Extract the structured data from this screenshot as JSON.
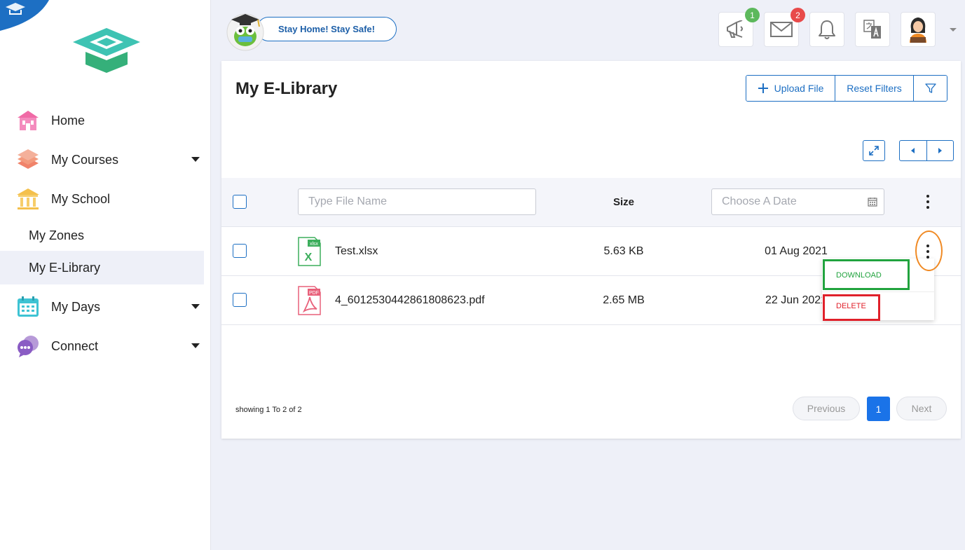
{
  "sidebar": {
    "items": [
      {
        "label": "Home"
      },
      {
        "label": "My Courses"
      },
      {
        "label": "My School"
      },
      {
        "label": "My Zones"
      },
      {
        "label": "My E-Library"
      },
      {
        "label": "My Days"
      },
      {
        "label": "Connect"
      }
    ]
  },
  "header": {
    "slogan": "Stay Home! Stay Safe!",
    "badges": {
      "announcements": "1",
      "messages": "2"
    }
  },
  "page": {
    "title": "My E-Library",
    "upload_label": "Upload File",
    "reset_label": "Reset Filters"
  },
  "table": {
    "file_name_placeholder": "Type File Name",
    "size_header": "Size",
    "date_placeholder": "Choose A Date",
    "rows": [
      {
        "name": "Test.xlsx",
        "type_label": "xlsx",
        "type_letter": "X",
        "size": "5.63 KB",
        "date": "01 Aug 2021"
      },
      {
        "name": "4_6012530442861808623.pdf",
        "type_label": "PDF",
        "size": "2.65 MB",
        "date": "22 Jun 2021"
      }
    ]
  },
  "row_menu": {
    "download_label": "DOWNLOAD",
    "delete_label": "DELETE"
  },
  "footer": {
    "showing_text": "showing 1 To 2 of 2",
    "previous_label": "Previous",
    "current_page": "1",
    "next_label": "Next"
  },
  "colors": {
    "accent": "#1d6fc3",
    "active_page": "#1a73e8",
    "download": "#21a33e",
    "delete": "#e0202a",
    "highlight_orange": "#f08a24"
  }
}
